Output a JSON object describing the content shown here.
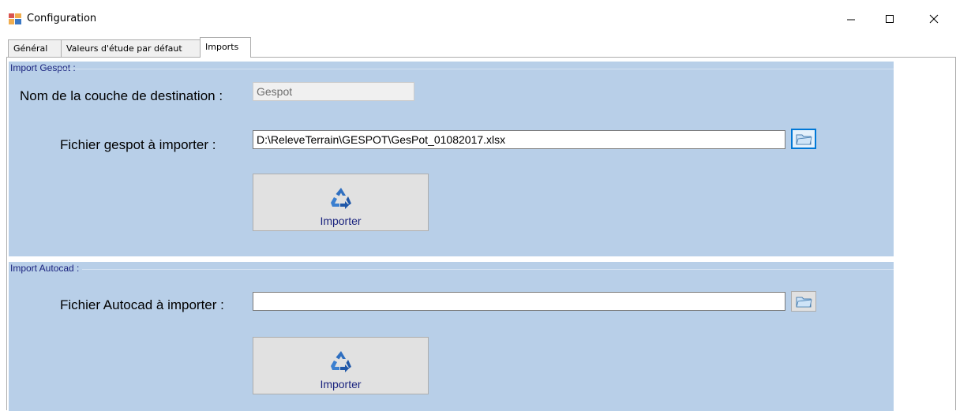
{
  "window": {
    "title": "Configuration",
    "controls": {
      "minimize": "minimize-icon",
      "maximize": "maximize-icon",
      "close": "close-icon"
    }
  },
  "tabs": [
    {
      "label": "Général",
      "active": false
    },
    {
      "label": "Valeurs d'étude par défaut",
      "active": false
    },
    {
      "label": "Imports",
      "active": true
    }
  ],
  "import_gespot": {
    "legend": "Import Gespot :",
    "layer_label": "Nom de la couche de destination :",
    "layer_value": "Gespot",
    "file_label": "Fichier gespot à importer :",
    "file_value": "D:\\ReleveTerrain\\GESPOT\\GesPot_01082017.xlsx",
    "browse_icon": "folder-browse-icon",
    "import_button": "Importer"
  },
  "import_autocad": {
    "legend": "Import Autocad :",
    "file_label": "Fichier Autocad à importer :",
    "file_value": "",
    "browse_icon": "folder-browse-icon",
    "import_button": "Importer"
  },
  "colors": {
    "group_background": "#b8cfe8",
    "legend_text": "#1a237e",
    "focus_border": "#0078d7"
  }
}
